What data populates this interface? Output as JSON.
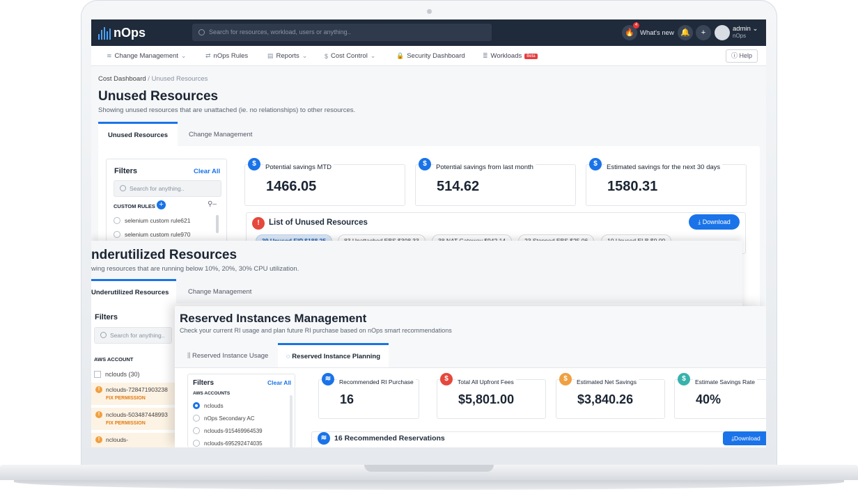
{
  "app": {
    "logo": "nOps",
    "search_placeholder": "Search for resources, workload, users or anything..",
    "whats_new": "What's new",
    "notif_count": "4",
    "user": "admin",
    "org": "nOps"
  },
  "menu": {
    "items": [
      "Change Management",
      "nOps Rules",
      "Reports",
      "Cost Control",
      "Security Dashboard",
      "Workloads"
    ],
    "beta": "Beta",
    "help": "Help"
  },
  "unused": {
    "breadcrumb": [
      "Cost Dashboard",
      "Unused Resources"
    ],
    "title": "Unused Resources",
    "subtitle": "Showing unused resources that are unattached (ie. no relationships) to other resources.",
    "tabs": [
      "Unused Resources",
      "Change Management"
    ],
    "filters": {
      "title": "Filters",
      "clear": "Clear All",
      "placeholder": "Search for anything..",
      "section": "CUSTOM RULES",
      "rules": [
        "selenium custom rule621",
        "selenium custom rule970"
      ]
    },
    "stats": [
      {
        "label": "Potential savings MTD",
        "value": "1466.05"
      },
      {
        "label": "Potential savings from last month",
        "value": "514.62"
      },
      {
        "label": "Estimated savings for the next 30 days",
        "value": "1580.31"
      }
    ],
    "list_title": "List of Unused Resources",
    "download": "Download",
    "chips": [
      "39 Unused EIP $188.25",
      "83 Unattached EBS $308.33",
      "38 NAT Gateway $942.14",
      "23 Stopped EBS $25.06",
      "10 Unused ELB $0.00"
    ]
  },
  "underutil": {
    "title": "nderutilized Resources",
    "subtitle": "wing resources that are running below 10%, 20%, 30% CPU utilization.",
    "tabs": [
      "Underutilized Resources",
      "Change Management"
    ],
    "filters": {
      "title": "Filters",
      "placeholder": "Search for anything..",
      "section": "AWS ACCOUNT",
      "account": "nclouds (30)",
      "items": [
        "nclouds-728471903238",
        "nclouds-503487448993",
        "nclouds-"
      ],
      "fix": "FIX PERMISSION"
    }
  },
  "ri": {
    "title": "Reserved Instances Management",
    "subtitle": "Check your current RI usage and plan future RI purchase based on nOps smart recommendations",
    "tabs": [
      "Reserved Instance Usage",
      "Reserved Instance Planning"
    ],
    "filters": {
      "title": "Filters",
      "clear": "Clear All",
      "section": "AWS ACCOUNTS",
      "accounts": [
        "nclouds",
        "nOps Secondary AC",
        "nclouds-915469964539",
        "nclouds-695292474035"
      ]
    },
    "stats": [
      {
        "label": "Recommended RI Purchase",
        "value": "16"
      },
      {
        "label": "Total All Upfront Fees",
        "value": "$5,801.00"
      },
      {
        "label": "Estimated Net Savings",
        "value": "$3,840.26"
      },
      {
        "label": "Estimate Savings Rate",
        "value": "40%"
      }
    ],
    "list_title": "16 Recommended Reservations",
    "download": "Download"
  }
}
